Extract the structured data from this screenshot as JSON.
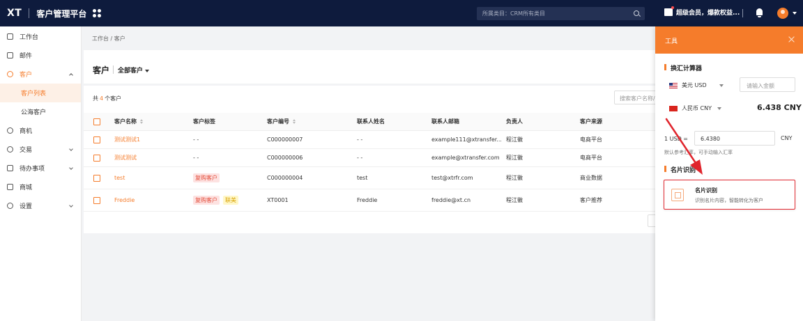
{
  "topbar": {
    "logo": "XT",
    "app_title": "客户管理平台",
    "search_placeholder": "所属类目：CRM所有类目",
    "promo": "超级会员，爆款权益..."
  },
  "sidebar": {
    "items": [
      {
        "label": "工作台",
        "icon": "monitor-icon"
      },
      {
        "label": "邮件",
        "icon": "mail-icon"
      },
      {
        "label": "客户",
        "icon": "customer-icon"
      },
      {
        "label": "客户列表"
      },
      {
        "label": "公海客户"
      },
      {
        "label": "商机",
        "icon": "opportunity-icon"
      },
      {
        "label": "交易",
        "icon": "trade-icon"
      },
      {
        "label": "待办事项",
        "icon": "calendar-icon"
      },
      {
        "label": "商城",
        "icon": "shop-icon"
      },
      {
        "label": "设置",
        "icon": "settings-icon"
      }
    ]
  },
  "breadcrumb": "工作台 / 客户",
  "header": {
    "title": "客户",
    "view": "全部客户"
  },
  "list": {
    "total_prefix": "共",
    "total_count": "4",
    "total_suffix": "个客户",
    "search_placeholder": "搜索客户名称/联系人",
    "columns": [
      "客户名称",
      "客户标签",
      "客户编号",
      "联系人姓名",
      "联系人邮箱",
      "负责人",
      "客户来源"
    ],
    "rows": [
      {
        "name": "测试测试1",
        "tags": [],
        "tag_text": "- -",
        "no": "C000000007",
        "contact": "- -",
        "email": "example111@xtransfer...",
        "owner": "程江徽",
        "source": "电商平台"
      },
      {
        "name": "测试测试",
        "tags": [],
        "tag_text": "- -",
        "no": "C000000006",
        "contact": "- -",
        "email": "example@xtransfer.com",
        "owner": "程江徽",
        "source": "电商平台"
      },
      {
        "name": "test",
        "tags": [
          "复购客户"
        ],
        "tag_text": "",
        "no": "C000000004",
        "contact": "test",
        "email": "test@xtrfr.com",
        "owner": "程江徽",
        "source": "商业数据"
      },
      {
        "name": "Freddie",
        "tags": [
          "复购客户",
          "联美"
        ],
        "tag_text": "",
        "no": "XT0001",
        "contact": "Freddie",
        "email": "freddie@xt.cn",
        "owner": "程江徽",
        "source": "客户推荐"
      }
    ]
  },
  "panel": {
    "title": "工具",
    "calc_title": "换汇计算器",
    "from_currency": "美元 USD",
    "amount_placeholder": "请输入金额",
    "to_currency": "人民币 CNY",
    "result": "6.438 CNY",
    "rate_label": "1 USD =",
    "rate_value": "6.4380",
    "rate_unit": "CNY",
    "rate_note": "默认参考汇率，可手动输入汇率",
    "ocr_section": "名片识别",
    "ocr_title": "名片识别",
    "ocr_desc": "识别名片内容，智能转化为客户"
  },
  "colors": {
    "accent": "#f57c2b",
    "topbar": "#0e1b3d",
    "highlight": "#e0252d"
  }
}
